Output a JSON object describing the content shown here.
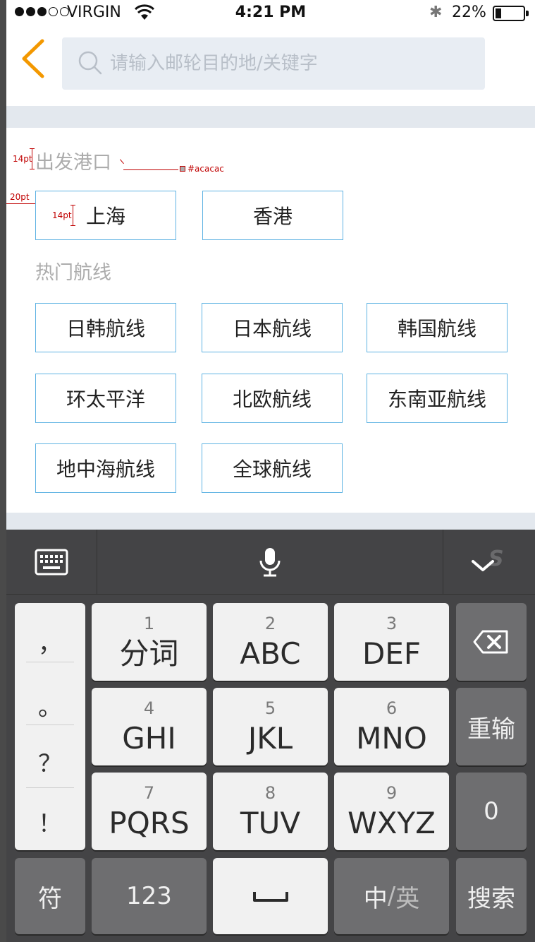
{
  "status_bar": {
    "carrier": "VIRGIN",
    "time": "4:21 PM",
    "battery_percent": "22%",
    "battery_level": 0.22
  },
  "search": {
    "placeholder": "请输入邮轮目的地/关键字"
  },
  "annotations": {
    "title_size": "14pt",
    "title_color": "#acacac",
    "left_margin": "20pt",
    "tag_size": "14pt"
  },
  "sections": {
    "departure_ports": {
      "title": "出发港口",
      "tags": [
        "上海",
        "香港"
      ]
    },
    "hot_routes": {
      "title": "热门航线",
      "tags": [
        "日韩航线",
        "日本航线",
        "韩国航线",
        "环太平洋",
        "北欧航线",
        "东南亚航线",
        "地中海航线",
        "全球航线"
      ]
    }
  },
  "colors": {
    "accent": "#f39800",
    "tag_border": "#5fb3e3",
    "title_gray": "#acacac",
    "band_gray": "#e3e8ee"
  },
  "keyboard": {
    "punctuation": [
      "，",
      "。",
      "？",
      "！"
    ],
    "keys": [
      {
        "num": "1",
        "label": "分词"
      },
      {
        "num": "2",
        "label": "ABC"
      },
      {
        "num": "3",
        "label": "DEF"
      },
      {
        "num": "4",
        "label": "GHI"
      },
      {
        "num": "5",
        "label": "JKL"
      },
      {
        "num": "6",
        "label": "MNO"
      },
      {
        "num": "7",
        "label": "PQRS"
      },
      {
        "num": "8",
        "label": "TUV"
      },
      {
        "num": "9",
        "label": "WXYZ"
      }
    ],
    "side_keys": {
      "retype": "重输",
      "zero": "0"
    },
    "bottom_row": {
      "symbols": "符",
      "numbers": "123",
      "lang_zh": "中",
      "lang_sep": "/",
      "lang_en": "英",
      "search": "搜索"
    }
  }
}
